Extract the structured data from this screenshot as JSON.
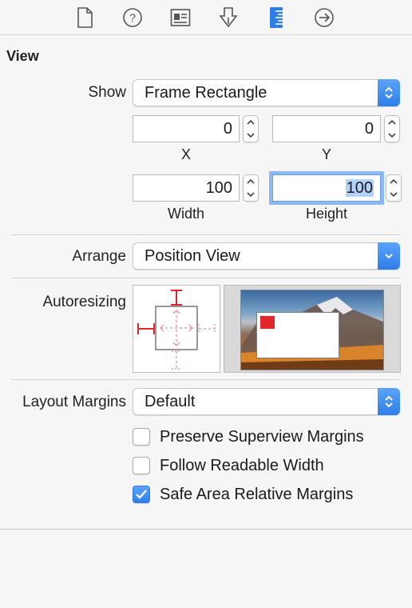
{
  "toolbar": {
    "icons": [
      "file-inspector-icon",
      "quick-help-icon",
      "identity-inspector-icon",
      "attributes-inspector-icon",
      "size-inspector-icon",
      "connections-inspector-icon"
    ],
    "active_icon": "size-inspector-icon",
    "accent": "#2f7de9"
  },
  "view": {
    "section_title": "View",
    "show_label": "Show",
    "show_value": "Frame Rectangle",
    "x_value": "0",
    "x_label": "X",
    "y_value": "0",
    "y_label": "Y",
    "width_value": "100",
    "width_label": "Width",
    "height_value": "100",
    "height_label": "Height",
    "arrange_label": "Arrange",
    "arrange_value": "Position View",
    "autoresizing_label": "Autoresizing"
  },
  "layout_margins": {
    "label": "Layout Margins",
    "value": "Default"
  },
  "checkboxes": [
    {
      "label": "Preserve Superview Margins",
      "checked": false
    },
    {
      "label": "Follow Readable Width",
      "checked": false
    },
    {
      "label": "Safe Area Relative Margins",
      "checked": true
    }
  ],
  "colors": {
    "autoresize_red": "#e4262a",
    "focus_ring": "#8cb8f3",
    "selection": "#b3d2fa"
  }
}
